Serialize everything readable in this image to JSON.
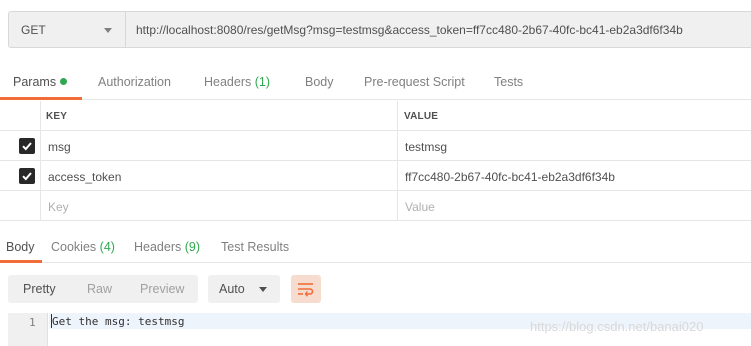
{
  "request": {
    "method": "GET",
    "url": "http://localhost:8080/res/getMsg?msg=testmsg&access_token=ff7cc480-2b67-40fc-bc41-eb2a3df6f34b"
  },
  "request_tabs": [
    {
      "label": "Params",
      "active": true,
      "has_dot": true
    },
    {
      "label": "Authorization"
    },
    {
      "label": "Headers",
      "count": "(1)"
    },
    {
      "label": "Body"
    },
    {
      "label": "Pre-request Script"
    },
    {
      "label": "Tests"
    }
  ],
  "params": {
    "header_key": "KEY",
    "header_value": "VALUE",
    "rows": [
      {
        "key": "msg",
        "value": "testmsg",
        "checked": true
      },
      {
        "key": "access_token",
        "value": "ff7cc480-2b67-40fc-bc41-eb2a3df6f34b",
        "checked": true
      }
    ],
    "placeholder_key": "Key",
    "placeholder_value": "Value"
  },
  "response_tabs": [
    {
      "label": "Body",
      "active": true
    },
    {
      "label": "Cookies",
      "count": "(4)"
    },
    {
      "label": "Headers",
      "count": "(9)"
    },
    {
      "label": "Test Results"
    }
  ],
  "response_toolbar": {
    "pretty": "Pretty",
    "raw": "Raw",
    "preview": "Preview",
    "format": "Auto",
    "wrap_icon": "wrap-lines-icon"
  },
  "response_body": {
    "line_number": "1",
    "text": "Get the msg: testmsg"
  },
  "watermark": "https://blog.csdn.net/banai020",
  "colors": {
    "accent": "#f26b3a",
    "count": "#2fa84f",
    "checkbox": "#282828"
  }
}
